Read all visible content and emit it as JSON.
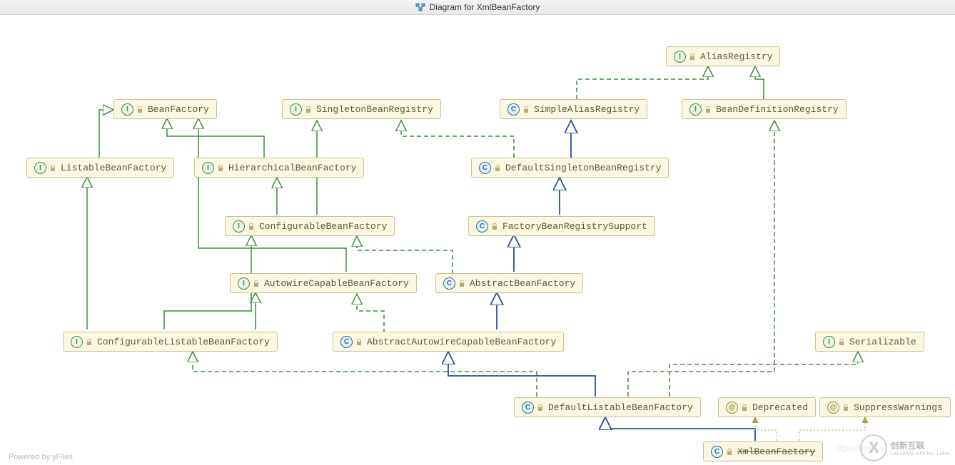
{
  "title": "Diagram for XmlBeanFactory",
  "footer": "Powered by yFiles",
  "watermark_left": "https://blog.cs",
  "logo_text": "创新互联",
  "logo_sub": "CHUANG XIN HU LIAN",
  "nodes": {
    "alias_registry": {
      "kind": "interface",
      "label": "AliasRegistry"
    },
    "bean_factory": {
      "kind": "interface",
      "label": "BeanFactory"
    },
    "singleton_bean_registry": {
      "kind": "interface",
      "label": "SingletonBeanRegistry"
    },
    "simple_alias_registry": {
      "kind": "class",
      "label": "SimpleAliasRegistry"
    },
    "bean_definition_registry": {
      "kind": "interface",
      "label": "BeanDefinitionRegistry"
    },
    "listable_bean_factory": {
      "kind": "interface",
      "label": "ListableBeanFactory"
    },
    "hierarchical_bean_factory": {
      "kind": "interface",
      "label": "HierarchicalBeanFactory"
    },
    "default_singleton_bean_registry": {
      "kind": "class",
      "label": "DefaultSingletonBeanRegistry"
    },
    "configurable_bean_factory": {
      "kind": "interface",
      "label": "ConfigurableBeanFactory"
    },
    "factory_bean_registry_support": {
      "kind": "class",
      "label": "FactoryBeanRegistrySupport"
    },
    "autowire_capable_bean_factory": {
      "kind": "interface",
      "label": "AutowireCapableBeanFactory"
    },
    "abstract_bean_factory": {
      "kind": "class",
      "label": "AbstractBeanFactory"
    },
    "configurable_listable_bean_factory": {
      "kind": "interface",
      "label": "ConfigurableListableBeanFactory"
    },
    "abstract_autowire_capable_bean_factory": {
      "kind": "class",
      "label": "AbstractAutowireCapableBeanFactory"
    },
    "serializable": {
      "kind": "interface",
      "label": "Serializable"
    },
    "default_listable_bean_factory": {
      "kind": "class",
      "label": "DefaultListableBeanFactory"
    },
    "deprecated": {
      "kind": "anno",
      "label": "Deprecated"
    },
    "suppress_warnings": {
      "kind": "anno",
      "label": "SuppressWarnings"
    },
    "xml_bean_factory": {
      "kind": "class",
      "label": "XmlBeanFactory",
      "strike": true
    }
  },
  "kind_letters": {
    "interface": "I",
    "class": "C",
    "anno": "@"
  },
  "diagram_meta": {
    "root": "XmlBeanFactory",
    "edge_style_legend": {
      "solid_green": "extends (interface→interface)",
      "dashed_green": "implements (class→interface)",
      "solid_blue": "extends (class→class)",
      "dotted_olive": "annotated-by"
    }
  },
  "chart_data": {
    "type": "diagram",
    "title": "Diagram for XmlBeanFactory",
    "nodes": [
      {
        "id": "AliasRegistry",
        "kind": "interface"
      },
      {
        "id": "BeanFactory",
        "kind": "interface"
      },
      {
        "id": "SingletonBeanRegistry",
        "kind": "interface"
      },
      {
        "id": "SimpleAliasRegistry",
        "kind": "class"
      },
      {
        "id": "BeanDefinitionRegistry",
        "kind": "interface"
      },
      {
        "id": "ListableBeanFactory",
        "kind": "interface"
      },
      {
        "id": "HierarchicalBeanFactory",
        "kind": "interface"
      },
      {
        "id": "DefaultSingletonBeanRegistry",
        "kind": "class"
      },
      {
        "id": "ConfigurableBeanFactory",
        "kind": "interface"
      },
      {
        "id": "FactoryBeanRegistrySupport",
        "kind": "class"
      },
      {
        "id": "AutowireCapableBeanFactory",
        "kind": "interface"
      },
      {
        "id": "AbstractBeanFactory",
        "kind": "class"
      },
      {
        "id": "ConfigurableListableBeanFactory",
        "kind": "interface"
      },
      {
        "id": "AbstractAutowireCapableBeanFactory",
        "kind": "class"
      },
      {
        "id": "Serializable",
        "kind": "interface"
      },
      {
        "id": "DefaultListableBeanFactory",
        "kind": "class"
      },
      {
        "id": "Deprecated",
        "kind": "annotation"
      },
      {
        "id": "SuppressWarnings",
        "kind": "annotation"
      },
      {
        "id": "XmlBeanFactory",
        "kind": "class",
        "deprecated": true
      }
    ],
    "edges": [
      {
        "from": "ListableBeanFactory",
        "to": "BeanFactory",
        "rel": "extends-interface"
      },
      {
        "from": "HierarchicalBeanFactory",
        "to": "BeanFactory",
        "rel": "extends-interface"
      },
      {
        "from": "AutowireCapableBeanFactory",
        "to": "BeanFactory",
        "rel": "extends-interface"
      },
      {
        "from": "ConfigurableBeanFactory",
        "to": "HierarchicalBeanFactory",
        "rel": "extends-interface"
      },
      {
        "from": "ConfigurableBeanFactory",
        "to": "SingletonBeanRegistry",
        "rel": "extends-interface"
      },
      {
        "from": "ConfigurableListableBeanFactory",
        "to": "ListableBeanFactory",
        "rel": "extends-interface"
      },
      {
        "from": "ConfigurableListableBeanFactory",
        "to": "AutowireCapableBeanFactory",
        "rel": "extends-interface"
      },
      {
        "from": "ConfigurableListableBeanFactory",
        "to": "ConfigurableBeanFactory",
        "rel": "extends-interface"
      },
      {
        "from": "BeanDefinitionRegistry",
        "to": "AliasRegistry",
        "rel": "extends-interface"
      },
      {
        "from": "SimpleAliasRegistry",
        "to": "AliasRegistry",
        "rel": "implements"
      },
      {
        "from": "DefaultSingletonBeanRegistry",
        "to": "SimpleAliasRegistry",
        "rel": "extends-class"
      },
      {
        "from": "DefaultSingletonBeanRegistry",
        "to": "SingletonBeanRegistry",
        "rel": "implements"
      },
      {
        "from": "FactoryBeanRegistrySupport",
        "to": "DefaultSingletonBeanRegistry",
        "rel": "extends-class"
      },
      {
        "from": "AbstractBeanFactory",
        "to": "FactoryBeanRegistrySupport",
        "rel": "extends-class"
      },
      {
        "from": "AbstractBeanFactory",
        "to": "ConfigurableBeanFactory",
        "rel": "implements"
      },
      {
        "from": "AbstractAutowireCapableBeanFactory",
        "to": "AbstractBeanFactory",
        "rel": "extends-class"
      },
      {
        "from": "AbstractAutowireCapableBeanFactory",
        "to": "AutowireCapableBeanFactory",
        "rel": "implements"
      },
      {
        "from": "DefaultListableBeanFactory",
        "to": "AbstractAutowireCapableBeanFactory",
        "rel": "extends-class"
      },
      {
        "from": "DefaultListableBeanFactory",
        "to": "ConfigurableListableBeanFactory",
        "rel": "implements"
      },
      {
        "from": "DefaultListableBeanFactory",
        "to": "BeanDefinitionRegistry",
        "rel": "implements"
      },
      {
        "from": "DefaultListableBeanFactory",
        "to": "Serializable",
        "rel": "implements"
      },
      {
        "from": "XmlBeanFactory",
        "to": "DefaultListableBeanFactory",
        "rel": "extends-class"
      },
      {
        "from": "XmlBeanFactory",
        "to": "Deprecated",
        "rel": "annotated-by"
      },
      {
        "from": "XmlBeanFactory",
        "to": "SuppressWarnings",
        "rel": "annotated-by"
      }
    ]
  }
}
